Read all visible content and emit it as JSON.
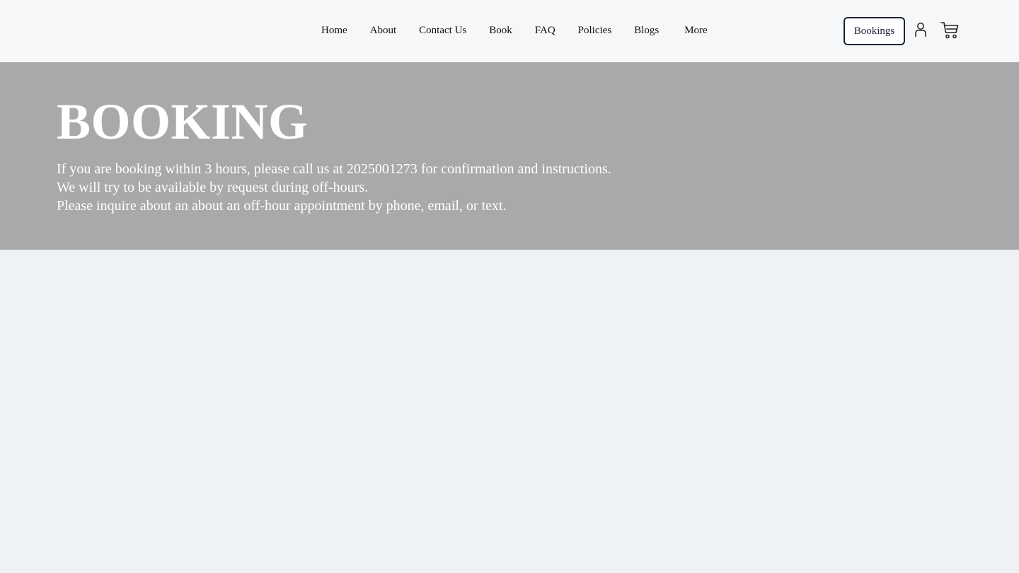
{
  "nav": {
    "items": [
      {
        "label": "Home"
      },
      {
        "label": "About"
      },
      {
        "label": "Contact Us"
      },
      {
        "label": "Book"
      },
      {
        "label": "FAQ"
      },
      {
        "label": "Policies"
      },
      {
        "label": "Blogs"
      },
      {
        "label": "More"
      }
    ]
  },
  "header": {
    "bookings_label": "Bookings",
    "user_icon": "user-icon",
    "cart_icon": "cart-icon"
  },
  "hero": {
    "title": "BOOKING",
    "lines": [
      "If you are booking within 3 hours, please call us at 2025001273 for confirmation and instructions.",
      "We will try to be available by request during off-hours.",
      "Please inquire about an about an off-hour appointment by phone, email, or text."
    ]
  },
  "colors": {
    "header_bg": "#f5f7f9",
    "hero_bg": "#a8a9ab",
    "page_bg": "#eef2f5",
    "accent": "#1a2236"
  }
}
